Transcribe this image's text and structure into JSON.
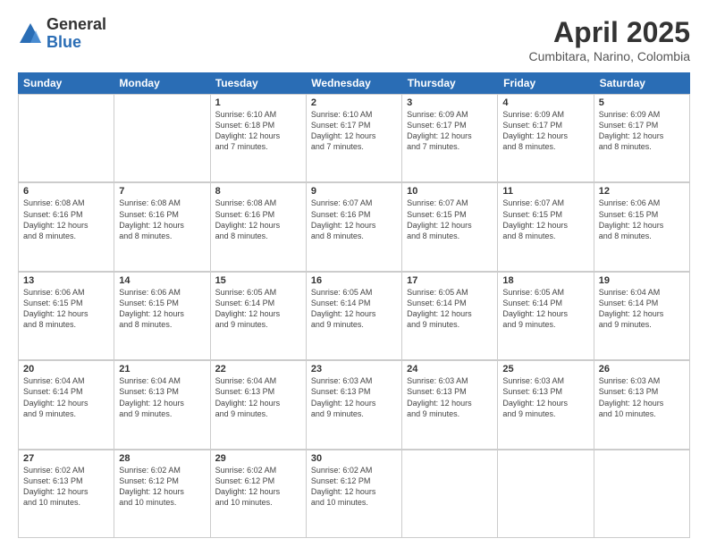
{
  "header": {
    "logo_general": "General",
    "logo_blue": "Blue",
    "month_title": "April 2025",
    "location": "Cumbitara, Narino, Colombia"
  },
  "weekdays": [
    "Sunday",
    "Monday",
    "Tuesday",
    "Wednesday",
    "Thursday",
    "Friday",
    "Saturday"
  ],
  "rows": [
    [
      {
        "day": "",
        "text": ""
      },
      {
        "day": "",
        "text": ""
      },
      {
        "day": "1",
        "text": "Sunrise: 6:10 AM\nSunset: 6:18 PM\nDaylight: 12 hours\nand 7 minutes."
      },
      {
        "day": "2",
        "text": "Sunrise: 6:10 AM\nSunset: 6:17 PM\nDaylight: 12 hours\nand 7 minutes."
      },
      {
        "day": "3",
        "text": "Sunrise: 6:09 AM\nSunset: 6:17 PM\nDaylight: 12 hours\nand 7 minutes."
      },
      {
        "day": "4",
        "text": "Sunrise: 6:09 AM\nSunset: 6:17 PM\nDaylight: 12 hours\nand 8 minutes."
      },
      {
        "day": "5",
        "text": "Sunrise: 6:09 AM\nSunset: 6:17 PM\nDaylight: 12 hours\nand 8 minutes."
      }
    ],
    [
      {
        "day": "6",
        "text": "Sunrise: 6:08 AM\nSunset: 6:16 PM\nDaylight: 12 hours\nand 8 minutes."
      },
      {
        "day": "7",
        "text": "Sunrise: 6:08 AM\nSunset: 6:16 PM\nDaylight: 12 hours\nand 8 minutes."
      },
      {
        "day": "8",
        "text": "Sunrise: 6:08 AM\nSunset: 6:16 PM\nDaylight: 12 hours\nand 8 minutes."
      },
      {
        "day": "9",
        "text": "Sunrise: 6:07 AM\nSunset: 6:16 PM\nDaylight: 12 hours\nand 8 minutes."
      },
      {
        "day": "10",
        "text": "Sunrise: 6:07 AM\nSunset: 6:15 PM\nDaylight: 12 hours\nand 8 minutes."
      },
      {
        "day": "11",
        "text": "Sunrise: 6:07 AM\nSunset: 6:15 PM\nDaylight: 12 hours\nand 8 minutes."
      },
      {
        "day": "12",
        "text": "Sunrise: 6:06 AM\nSunset: 6:15 PM\nDaylight: 12 hours\nand 8 minutes."
      }
    ],
    [
      {
        "day": "13",
        "text": "Sunrise: 6:06 AM\nSunset: 6:15 PM\nDaylight: 12 hours\nand 8 minutes."
      },
      {
        "day": "14",
        "text": "Sunrise: 6:06 AM\nSunset: 6:15 PM\nDaylight: 12 hours\nand 8 minutes."
      },
      {
        "day": "15",
        "text": "Sunrise: 6:05 AM\nSunset: 6:14 PM\nDaylight: 12 hours\nand 9 minutes."
      },
      {
        "day": "16",
        "text": "Sunrise: 6:05 AM\nSunset: 6:14 PM\nDaylight: 12 hours\nand 9 minutes."
      },
      {
        "day": "17",
        "text": "Sunrise: 6:05 AM\nSunset: 6:14 PM\nDaylight: 12 hours\nand 9 minutes."
      },
      {
        "day": "18",
        "text": "Sunrise: 6:05 AM\nSunset: 6:14 PM\nDaylight: 12 hours\nand 9 minutes."
      },
      {
        "day": "19",
        "text": "Sunrise: 6:04 AM\nSunset: 6:14 PM\nDaylight: 12 hours\nand 9 minutes."
      }
    ],
    [
      {
        "day": "20",
        "text": "Sunrise: 6:04 AM\nSunset: 6:14 PM\nDaylight: 12 hours\nand 9 minutes."
      },
      {
        "day": "21",
        "text": "Sunrise: 6:04 AM\nSunset: 6:13 PM\nDaylight: 12 hours\nand 9 minutes."
      },
      {
        "day": "22",
        "text": "Sunrise: 6:04 AM\nSunset: 6:13 PM\nDaylight: 12 hours\nand 9 minutes."
      },
      {
        "day": "23",
        "text": "Sunrise: 6:03 AM\nSunset: 6:13 PM\nDaylight: 12 hours\nand 9 minutes."
      },
      {
        "day": "24",
        "text": "Sunrise: 6:03 AM\nSunset: 6:13 PM\nDaylight: 12 hours\nand 9 minutes."
      },
      {
        "day": "25",
        "text": "Sunrise: 6:03 AM\nSunset: 6:13 PM\nDaylight: 12 hours\nand 9 minutes."
      },
      {
        "day": "26",
        "text": "Sunrise: 6:03 AM\nSunset: 6:13 PM\nDaylight: 12 hours\nand 10 minutes."
      }
    ],
    [
      {
        "day": "27",
        "text": "Sunrise: 6:02 AM\nSunset: 6:13 PM\nDaylight: 12 hours\nand 10 minutes."
      },
      {
        "day": "28",
        "text": "Sunrise: 6:02 AM\nSunset: 6:12 PM\nDaylight: 12 hours\nand 10 minutes."
      },
      {
        "day": "29",
        "text": "Sunrise: 6:02 AM\nSunset: 6:12 PM\nDaylight: 12 hours\nand 10 minutes."
      },
      {
        "day": "30",
        "text": "Sunrise: 6:02 AM\nSunset: 6:12 PM\nDaylight: 12 hours\nand 10 minutes."
      },
      {
        "day": "",
        "text": ""
      },
      {
        "day": "",
        "text": ""
      },
      {
        "day": "",
        "text": ""
      }
    ]
  ]
}
